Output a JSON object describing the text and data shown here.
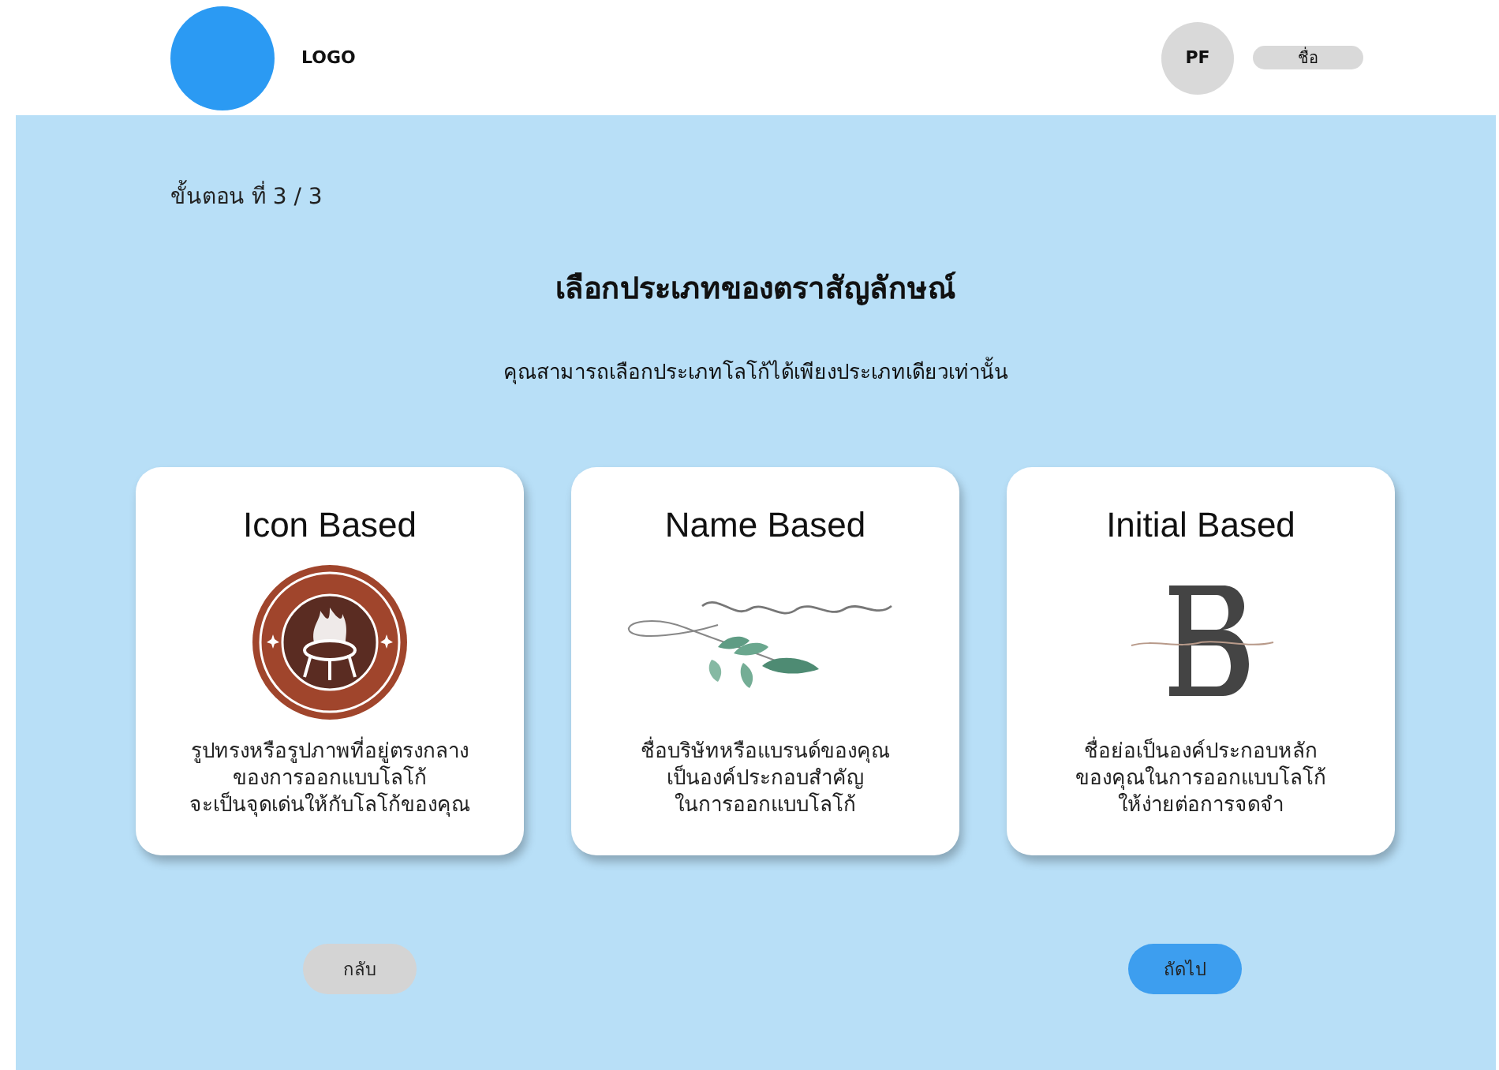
{
  "header": {
    "logo_text": "LOGO",
    "avatar_initials": "PF",
    "user_name": "ชื่อ"
  },
  "step": "ขั้นตอน ที่ 3 / 3",
  "title": "เลือกประเภทของตราสัญลักษณ์",
  "subtitle": "คุณสามารถเลือกประเภทโลโก้ได้เพียงประเภทเดียวเท่านั้น",
  "cards": [
    {
      "kind": "icon",
      "title": "Icon Based",
      "description": "รูปทรงหรือรูปภาพที่อยู่ตรงกลาง\nของการออกแบบโลโก้\nจะเป็นจุดเด่นให้กับโลโก้ของคุณ"
    },
    {
      "kind": "name",
      "title": "Name Based",
      "description": "ชื่อบริษัทหรือแบรนด์ของคุณ\nเป็นองค์ประกอบสำคัญ\nในการออกแบบโลโก้"
    },
    {
      "kind": "initial",
      "title": "Initial Based",
      "description": "ชื่อย่อเป็นองค์ประกอบหลัก\nของคุณในการออกแบบโลโก้\nให้ง่ายต่อการจดจำ"
    }
  ],
  "buttons": {
    "back": "กลับ",
    "next": "ถัดไป"
  }
}
